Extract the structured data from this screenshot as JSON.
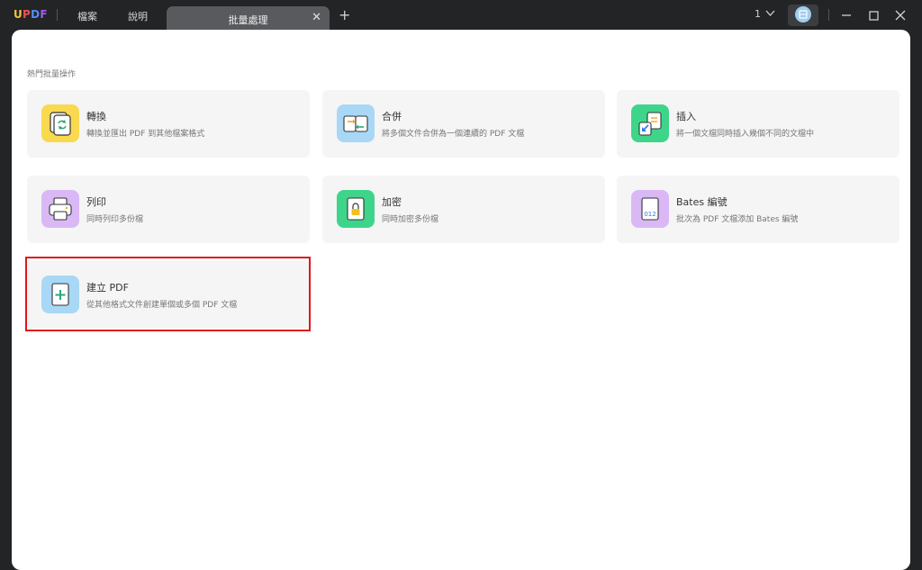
{
  "app": {
    "logo": "UPDF"
  },
  "menu": {
    "file": "檔案",
    "help": "說明"
  },
  "tab": {
    "title": "批量處理",
    "close": "✕",
    "new": "+"
  },
  "window": {
    "page_count": "1"
  },
  "section": {
    "title": "熱門批量操作"
  },
  "cards": [
    {
      "title": "轉換",
      "desc": "轉換並匯出 PDF 到其他檔案格式",
      "icon": "convert-icon",
      "color": "#f9d94f"
    },
    {
      "title": "合併",
      "desc": "將多個文件合併為一個連續的 PDF 文檔",
      "icon": "merge-icon",
      "color": "#a8d8f5"
    },
    {
      "title": "插入",
      "desc": "將一個文檔同時插入幾個不同的文檔中",
      "icon": "insert-icon",
      "color": "#3ed58b"
    },
    {
      "title": "列印",
      "desc": "同時列印多份檔",
      "icon": "print-icon",
      "color": "#d9b8f5"
    },
    {
      "title": "加密",
      "desc": "同時加密多份檔",
      "icon": "encrypt-icon",
      "color": "#3ed58b"
    },
    {
      "title": "Bates 編號",
      "desc": "批次為 PDF 文檔添加 Bates 編號",
      "icon": "bates-icon",
      "color": "#d9b8f5",
      "icon_text": "012"
    },
    {
      "title": "建立 PDF",
      "desc": "從其他格式文件創建單個或多個 PDF 文檔",
      "icon": "create-pdf-icon",
      "color": "#a8d8f5"
    }
  ]
}
